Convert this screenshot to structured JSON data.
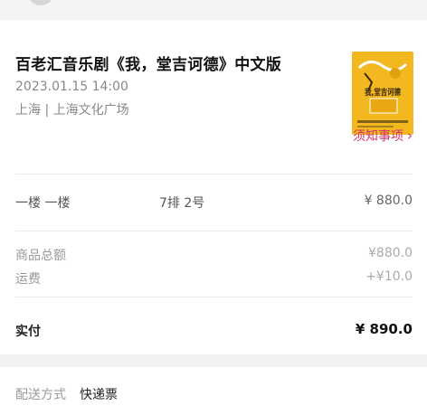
{
  "show": {
    "title": "百老汇音乐剧《我，堂吉诃德》中文版",
    "datetime": "2023.01.15 14:00",
    "venue": "上海 | 上海文化广场",
    "poster_text": "我,堂吉诃德"
  },
  "notice": {
    "label": "须知事项",
    "icon": "chevron-right-icon"
  },
  "ticket": {
    "area": "一楼 一楼",
    "seat": "7排 2号",
    "price": "¥ 880.0"
  },
  "fees": {
    "subtotal_label": "商品总额",
    "subtotal_value": "¥880.0",
    "shipping_label": "运费",
    "shipping_value": "+¥10.0"
  },
  "total": {
    "label": "实付",
    "value": "¥ 890.0"
  },
  "delivery": {
    "label": "配送方式",
    "value": "快递票"
  },
  "colors": {
    "accent": "#d6336c",
    "poster": "#f3b820",
    "background": "#f2f2f2"
  }
}
